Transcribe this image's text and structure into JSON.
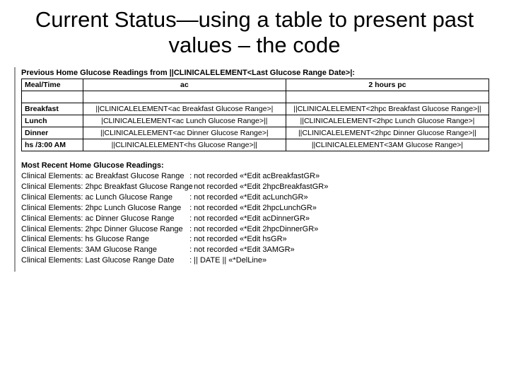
{
  "title": "Current Status—using a table to present past values – the code",
  "prev_heading": "Previous Home Glucose Readings from ||CLINICALELEMENT<Last Glucose Range Date>|:",
  "table": {
    "headers": [
      "Meal/Time",
      "ac",
      "2 hours pc"
    ],
    "rows": [
      {
        "meal": "",
        "ac": "",
        "pc": ""
      },
      {
        "meal": "Breakfast",
        "ac": "||CLINICALELEMENT<ac Breakfast Glucose Range>|",
        "pc": "||CLINICALELEMENT<2hpc Breakfast Glucose Range>||"
      },
      {
        "meal": "Lunch",
        "ac": "|CLINICALELEMENT<ac Lunch Glucose Range>||",
        "pc": "||CLINICALELEMENT<2hpc Lunch Glucose Range>|"
      },
      {
        "meal": "Dinner",
        "ac": "||CLINICALELEMENT<ac Dinner Glucose Range>|",
        "pc": "||CLINICALELEMENT<2hpc Dinner Glucose Range>||"
      },
      {
        "meal": "hs /3:00 AM",
        "ac": "||CLINICALELEMENT<hs Glucose Range>||",
        "pc": "||CLINICALELEMENT<3AM Glucose Range>|"
      }
    ]
  },
  "recent_heading": "Most Recent Home Glucose Readings:",
  "recent_rows": [
    {
      "label": "Clinical Elements: ac Breakfast Glucose Range",
      "value": ": not recorded «*Edit acBreakfastGR»"
    },
    {
      "label": "Clinical Elements: 2hpc Breakfast Glucose Range",
      "value": ": not recorded «*Edit 2hpcBreakfastGR»"
    },
    {
      "label": "Clinical Elements: ac Lunch Glucose Range",
      "value": ": not recorded «*Edit acLunchGR»"
    },
    {
      "label": "Clinical Elements: 2hpc Lunch Glucose Range",
      "value": ": not recorded «*Edit 2hpcLunchGR»"
    },
    {
      "label": "Clinical Elements: ac Dinner Glucose Range",
      "value": ": not recorded «*Edit acDinnerGR»"
    },
    {
      "label": "Clinical Elements: 2hpc Dinner Glucose Range",
      "value": ": not recorded «*Edit 2hpcDinnerGR»"
    },
    {
      "label": "Clinical Elements: hs Glucose Range",
      "value": ": not recorded «*Edit hsGR»"
    },
    {
      "label": "Clinical Elements: 3AM Glucose Range",
      "value": ": not recorded «*Edit 3AMGR»"
    },
    {
      "label": "Clinical Elements: Last Glucose Range Date",
      "value": ": || DATE ||    «*DelLine»"
    }
  ]
}
